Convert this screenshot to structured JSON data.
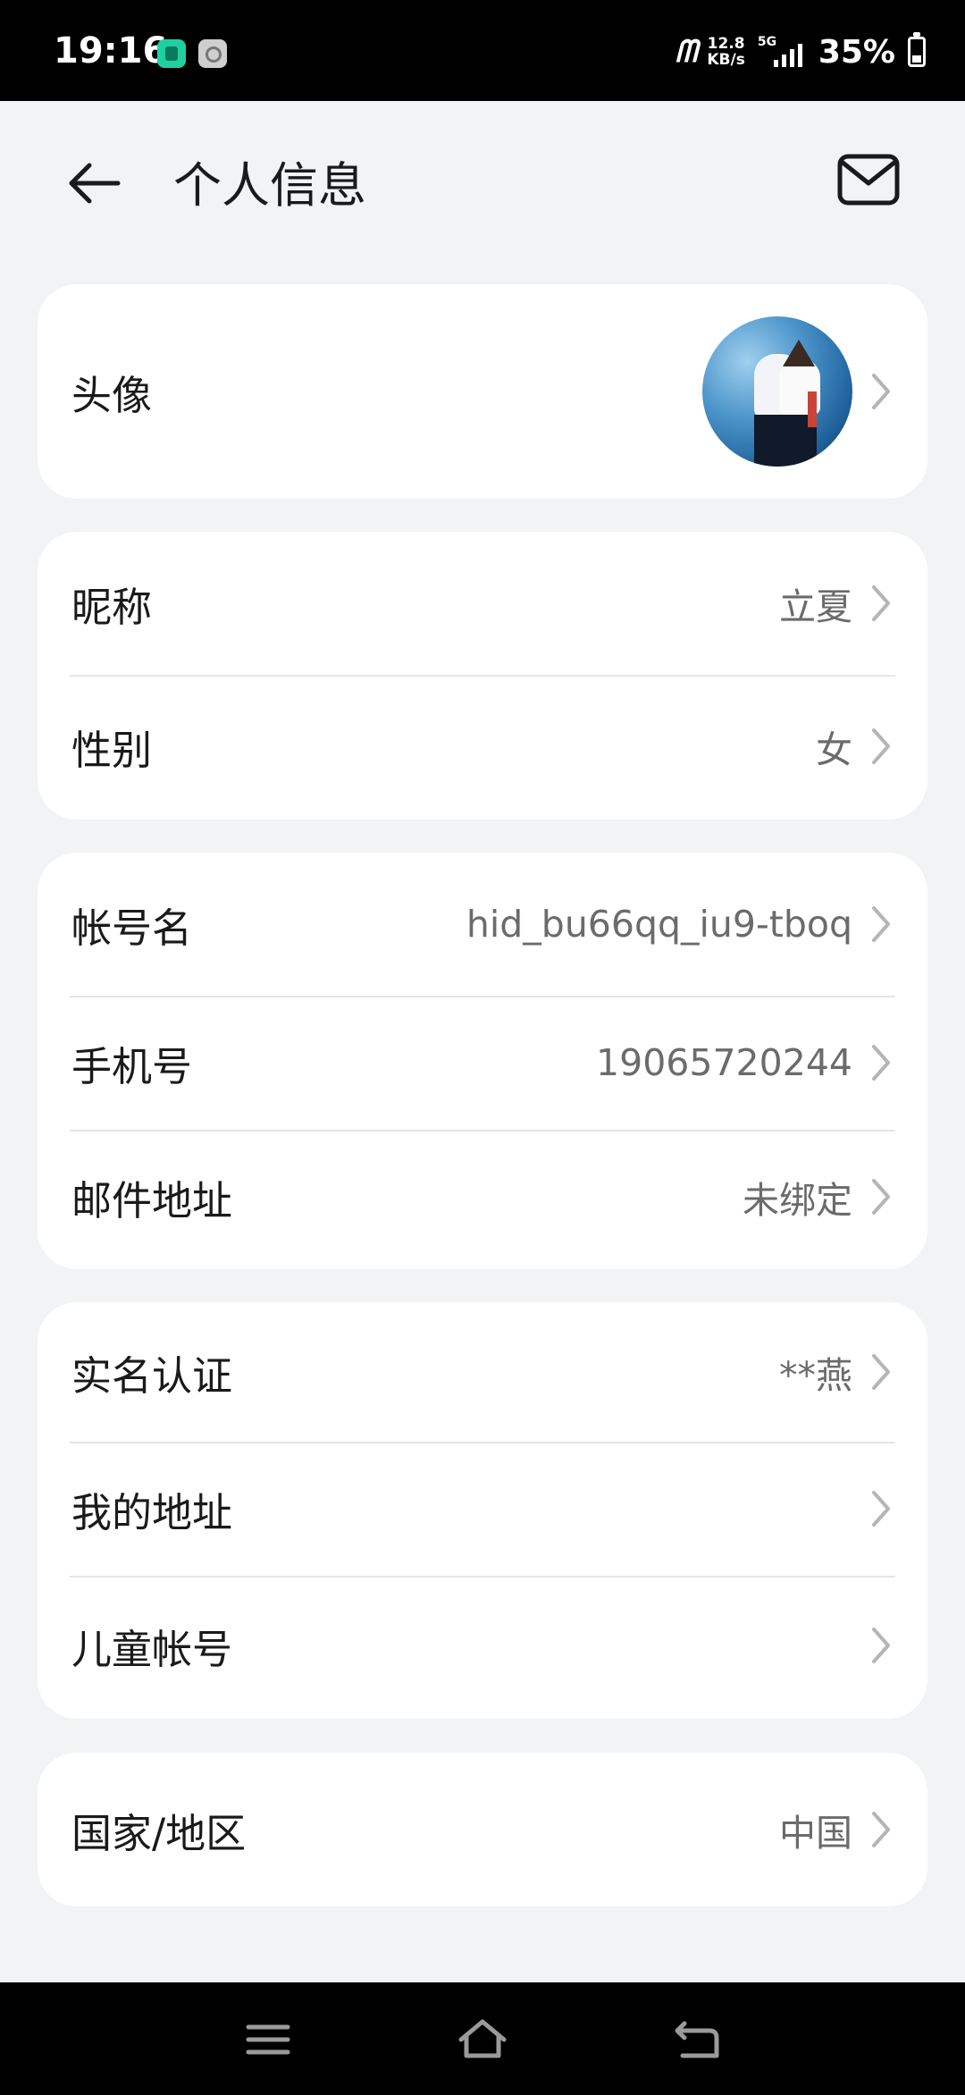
{
  "status_bar": {
    "time": "19:16",
    "network_label": "ᗰ",
    "speed_value": "12.8",
    "speed_unit": "KB/s",
    "signal_type": "5G",
    "battery_text": "35%",
    "battery_level": 0.35
  },
  "header": {
    "title": "个人信息",
    "back_icon": "arrow-left-icon",
    "mail_icon": "mail-icon"
  },
  "cards": {
    "avatar": {
      "label": "头像"
    },
    "profile": {
      "nickname_label": "昵称",
      "nickname_value": "立夏",
      "gender_label": "性别",
      "gender_value": "女"
    },
    "account": {
      "account_name_label": "帐号名",
      "account_name_value": "hid_bu66qq_iu9-tboq",
      "phone_label": "手机号",
      "phone_value": "19065720244",
      "email_label": "邮件地址",
      "email_value": "未绑定"
    },
    "identity": {
      "realname_label": "实名认证",
      "realname_value": "**燕",
      "address_label": "我的地址",
      "child_label": "儿童帐号"
    },
    "region": {
      "country_label": "国家/地区",
      "country_value": "中国"
    }
  },
  "nav_bar": {
    "menu_icon": "menu-icon",
    "home_icon": "home-icon",
    "back_icon": "back-nav-icon"
  },
  "colors": {
    "background": "#f2f3f5",
    "card": "#ffffff",
    "secondary_text": "#6b6b6b",
    "divider": "#e5e5e5"
  }
}
